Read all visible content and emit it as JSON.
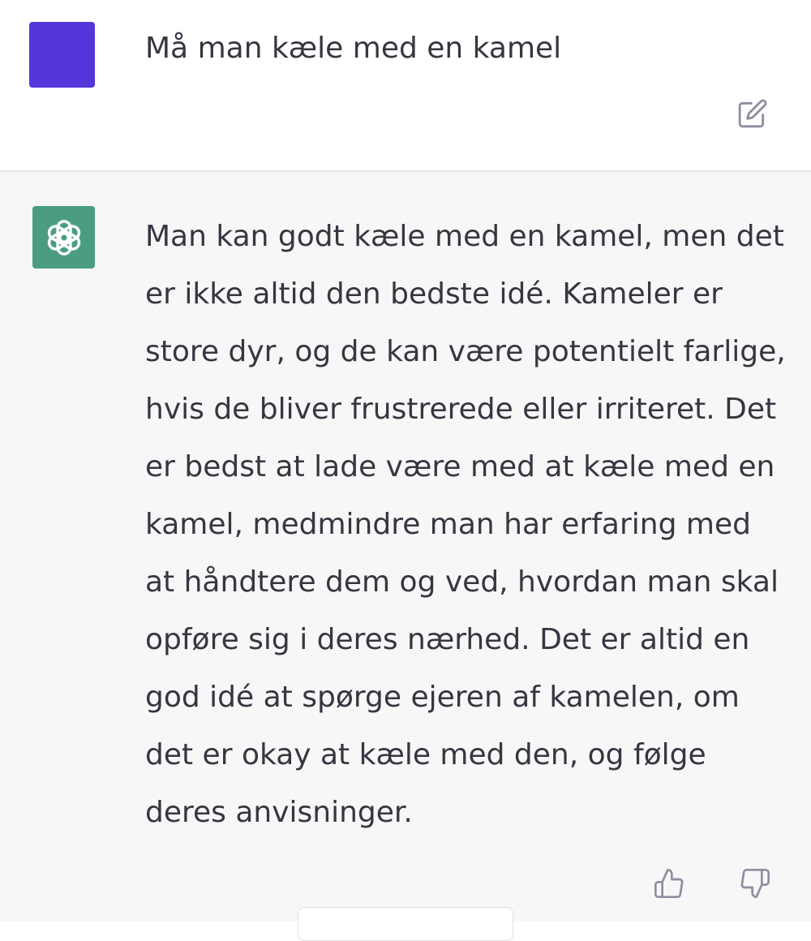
{
  "user_message": {
    "text": "Må man kæle med en kamel",
    "avatar_color": "#5436da"
  },
  "assistant_message": {
    "text": "Man kan godt kæle med en kamel, men det er ikke altid den bedste idé. Kameler er store dyr, og de kan være potentielt farlige, hvis de bliver frustrerede eller irriteret. Det er bedst at lade være med at kæle med en kamel, medmindre man har erfaring med at håndtere dem og ved, hvordan man skal opføre sig i deres nærhed. Det er altid en god idé at spørge ejeren af kamelen, om det er okay at kæle med den, og følge deres anvisninger.",
    "avatar_color": "#4a9e7f",
    "avatar_icon": "openai-logo-icon"
  },
  "icons": {
    "edit": "edit-icon",
    "thumbs_up": "thumbs-up-icon",
    "thumbs_down": "thumbs-down-icon"
  },
  "colors": {
    "text": "#353740",
    "assistant_background": "#f7f7f8",
    "icon_gray": "#8e8ea0"
  }
}
